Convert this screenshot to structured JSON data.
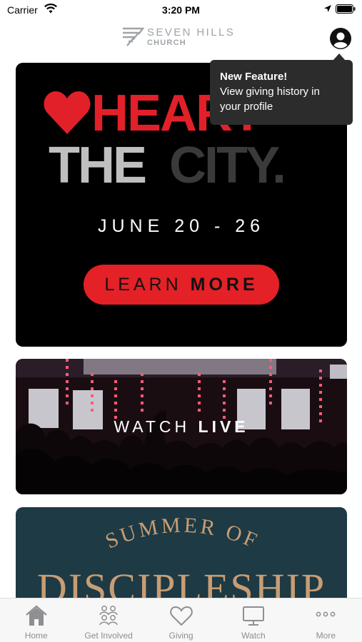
{
  "status_bar": {
    "carrier": "Carrier",
    "time": "3:20 PM"
  },
  "header": {
    "brand_line1": "SEVEN HILLS",
    "brand_line2": "CHURCH",
    "profile_icon": "person-circle-icon"
  },
  "tooltip": {
    "title": "New Feature!",
    "text": "View giving history in your profile"
  },
  "cards": {
    "heart": {
      "heart_word": "HEART",
      "the_word": "THE",
      "city_word": "CITY.",
      "dates": "JUNE 20 - 26",
      "button_light": "LEARN ",
      "button_bold": "MORE"
    },
    "live": {
      "label_light": "WATCH ",
      "label_bold": "LIVE"
    },
    "summer": {
      "line1": "SUMMER OF",
      "line2": "DISCIPLESHIP"
    }
  },
  "tabs": [
    {
      "label": "Home",
      "icon": "home-icon"
    },
    {
      "label": "Get Involved",
      "icon": "people-icon"
    },
    {
      "label": "Giving",
      "icon": "heart-icon"
    },
    {
      "label": "Watch",
      "icon": "monitor-icon"
    },
    {
      "label": "More",
      "icon": "ellipsis-icon"
    }
  ],
  "colors": {
    "accent_red": "#e32127",
    "tooltip_bg": "#2c2c2c",
    "brand_gray": "#a0a4a8",
    "summer_gold": "#c99d72"
  }
}
